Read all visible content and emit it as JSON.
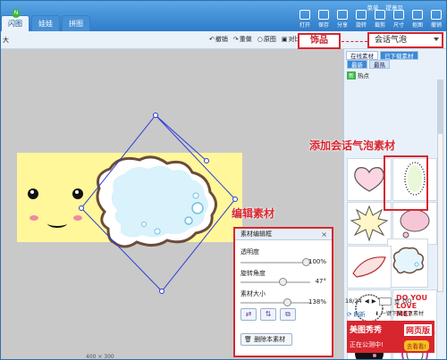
{
  "window": {
    "tabs": [
      {
        "label": "闪图"
      },
      {
        "label": "娃娃"
      },
      {
        "label": "拼图"
      }
    ],
    "badge": "N",
    "top_menu": [
      "菜单",
      "提意见"
    ],
    "toolbar": [
      "打开",
      "保存",
      "分享",
      "旋转",
      "裁剪",
      "尺寸",
      "抠图",
      "撤销"
    ]
  },
  "subbar": {
    "left_text": "大",
    "undo": "撤销",
    "redo": "重做",
    "original": "原图",
    "contrast": "对比"
  },
  "accessory_label": "饰品",
  "dropdown": {
    "value": "会话气泡"
  },
  "right_panel": {
    "tabs": [
      "在线素材",
      "已下载素材"
    ],
    "subtabs": [
      "最新",
      "最热"
    ],
    "new_badge": "新",
    "category": "热点",
    "pager": {
      "page": "18/24",
      "total_label": "页"
    },
    "refresh": "刷新",
    "download": "一键下载本页素材",
    "stickers": [
      {
        "name": "heart-bubble"
      },
      {
        "name": "dotted-bubble"
      },
      {
        "name": "spiky-bubble"
      },
      {
        "name": "pink-bubble"
      },
      {
        "name": "fluffy-bubble"
      },
      {
        "name": "leaf-bubble"
      },
      {
        "name": "round-bubble"
      },
      {
        "name": "do-you-love-me",
        "text": "DO YOU LOVE ME?"
      },
      {
        "name": "black-bubble"
      },
      {
        "name": "ornate-bubble"
      }
    ]
  },
  "ad": {
    "line1": "美图秀秀",
    "badge": "网页版",
    "line2": "正在公测中!",
    "button": "去看看!"
  },
  "annotations": {
    "accessory": "饰品",
    "add_material": "添加会话气泡素材",
    "edit_material": "编辑素材"
  },
  "editor": {
    "title": "素材编辑框",
    "transparency_label": "透明度",
    "transparency_value": "100%",
    "transparency": 1.0,
    "rotation_label": "旋转角度",
    "rotation_value": "47°",
    "rotation": 0.63,
    "size_label": "素材大小",
    "size_value": "138%",
    "size": 0.69,
    "delete_label": "删除本素材"
  },
  "canvas": {
    "size_text": "400 × 300"
  },
  "colors": {
    "accent": "#d8262f",
    "title": "#2f7cc9",
    "canvas_bg": "#c9c9c9",
    "photo_bg": "#fff79a"
  }
}
